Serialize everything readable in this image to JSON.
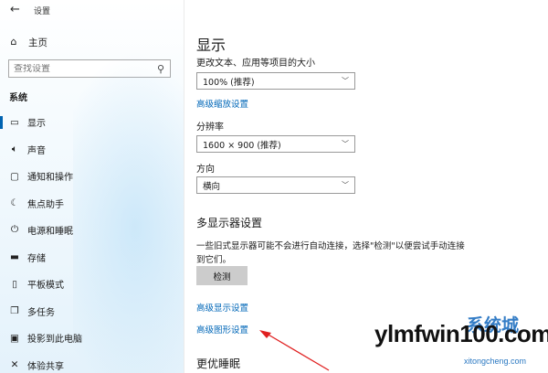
{
  "window": {
    "title": "设置"
  },
  "sidebar": {
    "home_label": "主页",
    "search_placeholder": "查找设置",
    "section_title": "系统",
    "items": [
      {
        "label": "显示",
        "icon": "monitor-icon",
        "active": true
      },
      {
        "label": "声音",
        "icon": "speaker-icon"
      },
      {
        "label": "通知和操作",
        "icon": "notification-icon"
      },
      {
        "label": "焦点助手",
        "icon": "moon-icon"
      },
      {
        "label": "电源和睡眠",
        "icon": "power-icon"
      },
      {
        "label": "存储",
        "icon": "storage-icon"
      },
      {
        "label": "平板模式",
        "icon": "tablet-icon"
      },
      {
        "label": "多任务",
        "icon": "multitask-icon"
      },
      {
        "label": "投影到此电脑",
        "icon": "project-icon"
      },
      {
        "label": "体验共享",
        "icon": "share-icon"
      }
    ]
  },
  "main": {
    "title": "显示",
    "scale_label": "更改文本、应用等项目的大小",
    "scale_value": "100% (推荐)",
    "advanced_scaling_link": "高级缩放设置",
    "resolution_label": "分辨率",
    "resolution_value": "1600 × 900 (推荐)",
    "orientation_label": "方向",
    "orientation_value": "横向",
    "multi_display_heading": "多显示器设置",
    "multi_display_desc": "一些旧式显示器可能不会进行自动连接，选择\"检测\"以便尝试手动连接到它们。",
    "detect_button": "检测",
    "advanced_display_link": "高级显示设置",
    "advanced_graphics_link": "高级图形设置",
    "sleep_heading": "更优睡眠"
  },
  "watermark": {
    "logo": "ylmfwin100.com",
    "brand": "系统城",
    "sub": "xitongcheng.com"
  },
  "colors": {
    "accent": "#0063b1",
    "link": "#0067b8",
    "arrow": "#e02020"
  }
}
